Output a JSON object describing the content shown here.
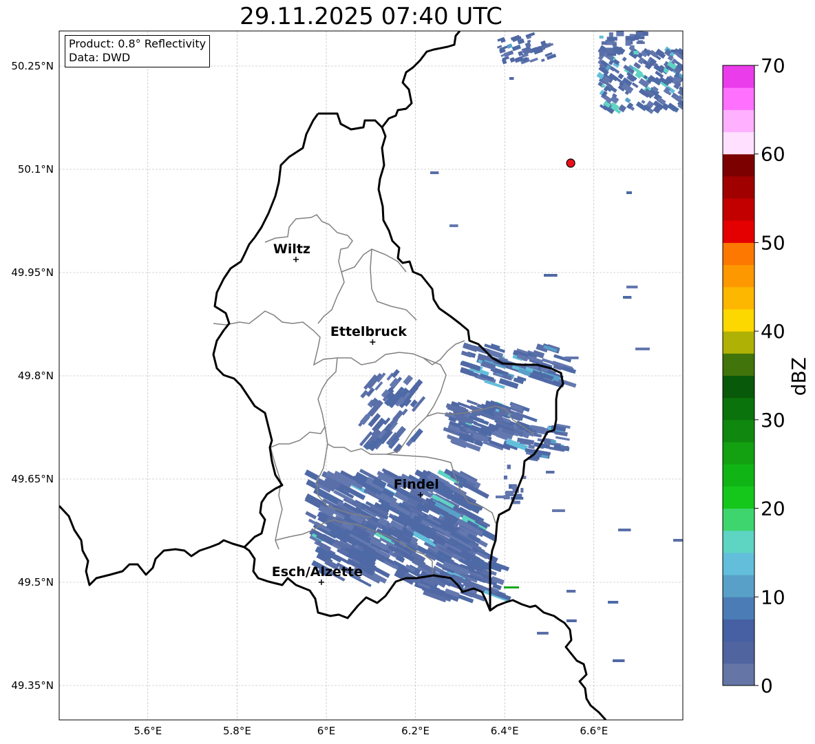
{
  "title": "29.11.2025 07:40 UTC",
  "info": {
    "product": "Product: 0.8° Reflectivity",
    "source": "Data: DWD"
  },
  "map": {
    "lon_range": [
      5.4,
      6.8
    ],
    "lat_range": [
      49.3,
      50.3
    ],
    "lat_ticks": [
      {
        "value": 50.25,
        "label": "50.25°N"
      },
      {
        "value": 50.1,
        "label": "50.1°N"
      },
      {
        "value": 49.95,
        "label": "49.95°N"
      },
      {
        "value": 49.8,
        "label": "49.8°N"
      },
      {
        "value": 49.65,
        "label": "49.65°N"
      },
      {
        "value": 49.5,
        "label": "49.5°N"
      },
      {
        "value": 49.35,
        "label": "49.35°N"
      }
    ],
    "lon_ticks": [
      {
        "value": 5.6,
        "label": "5.6°E"
      },
      {
        "value": 5.8,
        "label": "5.8°E"
      },
      {
        "value": 6.0,
        "label": "6°E"
      },
      {
        "value": 6.2,
        "label": "6.2°E"
      },
      {
        "value": 6.4,
        "label": "6.4°E"
      },
      {
        "value": 6.6,
        "label": "6.6°E"
      }
    ],
    "cities": [
      {
        "name": "Wiltz",
        "lon": 5.932,
        "lat": 49.969
      },
      {
        "name": "Ettelbruck",
        "lon": 6.104,
        "lat": 49.849
      },
      {
        "name": "Findel",
        "lon": 6.211,
        "lat": 49.627
      },
      {
        "name": "Esch/Alzette",
        "lon": 5.989,
        "lat": 49.5
      }
    ],
    "radar_site": {
      "lon": 6.548,
      "lat": 50.109,
      "color": "#e8101a"
    },
    "grid": true,
    "border_color": "#000000",
    "canton_color": "#808080"
  },
  "colorbar": {
    "label": "dBZ",
    "min": 0,
    "max": 70,
    "ticks": [
      "0",
      "10",
      "20",
      "30",
      "40",
      "50",
      "60",
      "70"
    ],
    "colors": [
      "#6475a6",
      "#5064a0",
      "#4660a3",
      "#4b7cb6",
      "#58a0c8",
      "#62bedb",
      "#5ed4c3",
      "#3ed56e",
      "#16c71b",
      "#10b515",
      "#13a011",
      "#10880f",
      "#0a730b",
      "#09590a",
      "#41740a",
      "#b0b105",
      "#fdd700",
      "#fdb700",
      "#fd9800",
      "#fd7800",
      "#e40000",
      "#c30000",
      "#a00000",
      "#7c0000",
      "#ffe0ff",
      "#ffb0ff",
      "#ff70ff",
      "#ea3cea"
    ]
  }
}
